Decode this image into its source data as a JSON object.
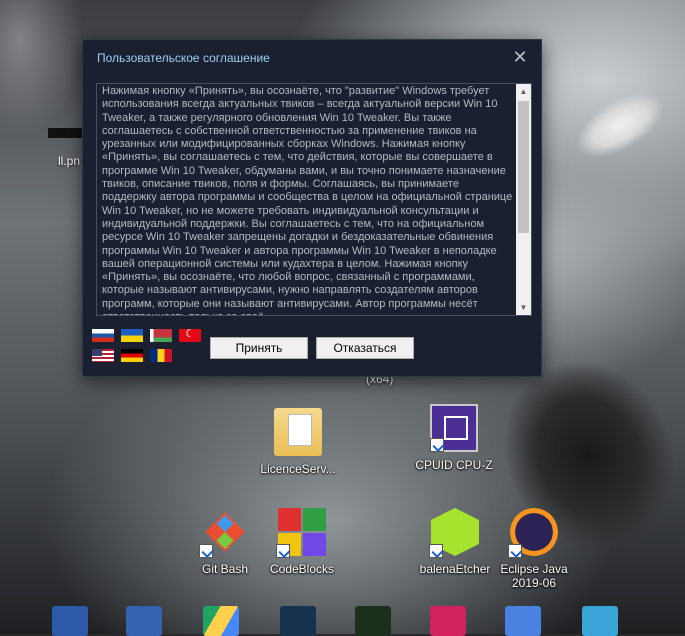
{
  "dialog": {
    "title": "Пользовательское соглашение",
    "close_icon": "close-icon",
    "agreement_text": "Нажимая кнопку «Принять», вы осознаёте, что \"развитие\" Windows требует использования всегда актуальных твиков – всегда актуальной версии Win 10 Tweaker, а также регулярного обновления Win 10 Tweaker. Вы также соглашаетесь с собственной ответственностью за применение твиков на урезанных или модифицированных сборках Windows. Нажимая кнопку «Принять», вы соглашаетесь с тем, что действия, которые вы совершаете в программе Win 10 Tweaker, обдуманы вами, и вы точно понимаете назначение твиков, описание твиков, поля и формы. Соглашаясь, вы принимаете поддержку автора программы и сообщества в целом на официальной странице Win 10 Tweaker, но не можете требовать индивидуальной консультации и индивидуальной поддержки. Вы соглашаетесь с тем, что на официальном ресурсе Win 10 Tweaker запрещены догадки и бездоказательные обвинения программы Win 10 Tweaker и автора программы Win 10 Tweaker в неполадке вашей операционной системы или кудахтера в целом. Нажимая кнопку «Принять», вы осознаёте, что любой вопрос, связанный с программами, которые называют антивирусами, нужно направлять создателям авторов программ, которые они называют антивирусами. Автор программы несёт ответственность только за своё",
    "accept_label": "Принять",
    "decline_label": "Отказаться",
    "language_flags": [
      "russia-flag-icon",
      "ukraine-flag-icon",
      "belarus-flag-icon",
      "turkey-flag-icon",
      "usa-flag-icon",
      "germany-flag-icon",
      "romania-flag-icon"
    ]
  },
  "desktop": {
    "partial_labels": {
      "top_left": "ll.pn",
      "hidden_under_dialog": "(x64)"
    },
    "icons": [
      {
        "label": "LicenceServ...",
        "icon": "folder-document-icon"
      },
      {
        "label": "CPUID CPU-Z",
        "icon": "cpu-z-icon"
      },
      {
        "label": "Git Bash",
        "icon": "git-bash-icon"
      },
      {
        "label": "CodeBlocks",
        "icon": "codeblocks-icon"
      },
      {
        "label": "balenaEtcher",
        "icon": "balena-etcher-icon"
      },
      {
        "label": "Eclipse Java\n2019-06",
        "icon": "eclipse-icon"
      }
    ],
    "bottom_row_icons": [
      "virtualbox-icon",
      "virtualbox-icon-2",
      "google-drive-icon",
      "steam-icon",
      "pycharm-icon",
      "intellij-icon",
      "goland-icon",
      "network-icon"
    ]
  }
}
